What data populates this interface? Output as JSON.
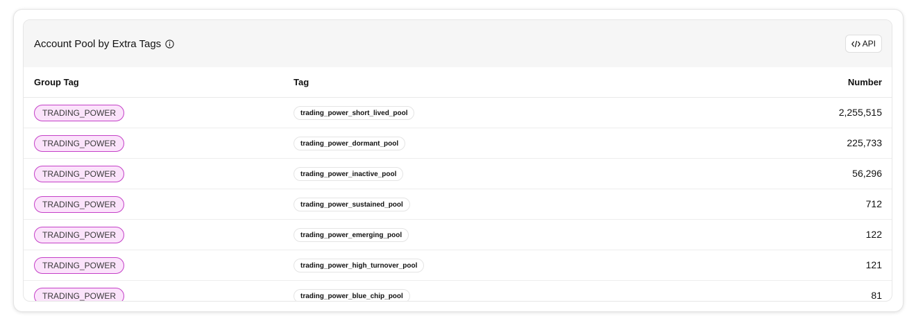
{
  "panel": {
    "title": "Account Pool by Extra Tags",
    "info_icon": "info-circle-icon",
    "api_button_label": "API",
    "api_icon": "code-icon"
  },
  "table": {
    "columns": [
      "Group Tag",
      "Tag",
      "Number"
    ],
    "rows": [
      {
        "group_tag": "TRADING_POWER",
        "tag": "trading_power_short_lived_pool",
        "number": "2,255,515"
      },
      {
        "group_tag": "TRADING_POWER",
        "tag": "trading_power_dormant_pool",
        "number": "225,733"
      },
      {
        "group_tag": "TRADING_POWER",
        "tag": "trading_power_inactive_pool",
        "number": "56,296"
      },
      {
        "group_tag": "TRADING_POWER",
        "tag": "trading_power_sustained_pool",
        "number": "712"
      },
      {
        "group_tag": "TRADING_POWER",
        "tag": "trading_power_emerging_pool",
        "number": "122"
      },
      {
        "group_tag": "TRADING_POWER",
        "tag": "trading_power_high_turnover_pool",
        "number": "121"
      },
      {
        "group_tag": "TRADING_POWER",
        "tag": "trading_power_blue_chip_pool",
        "number": "81"
      }
    ]
  },
  "colors": {
    "group_tag_border": "#c43fc7",
    "group_tag_bg": "#fbe3fb",
    "header_bg": "#f6f6f6"
  }
}
